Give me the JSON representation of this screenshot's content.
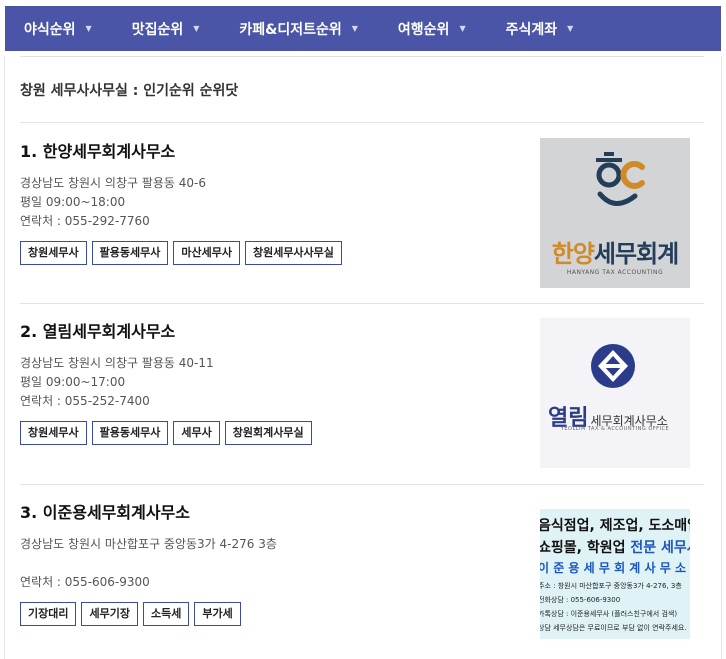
{
  "nav": {
    "items": [
      {
        "label": "야식순위"
      },
      {
        "label": "맛집순위"
      },
      {
        "label": "카페&디저트순위"
      },
      {
        "label": "여행순위"
      },
      {
        "label": "주식계좌"
      }
    ]
  },
  "page": {
    "title": "창원 세무사사무실 : 인기순위 순위닷"
  },
  "entries": [
    {
      "name": "1. 한양세무회계사무소",
      "address": "경상남도 창원시 의창구 팔용동 40-6",
      "hours": "평일 09:00~18:00",
      "phone": "연락처 : 055-292-7760",
      "tags": [
        "창원세무사",
        "팔용동세무사",
        "마산세무사",
        "창원세무사사무실"
      ],
      "thumb": {
        "brand": "한양세무회계",
        "brand_a": "한양",
        "brand_b": "세무회계",
        "eng": "HANYANG TAX ACCOUNTING"
      }
    },
    {
      "name": "2. 열림세무회계사무소",
      "address": "경상남도 창원시 의창구 팔용동 40-11",
      "hours": "평일 09:00~17:00",
      "phone": "연락처 : 055-252-7400",
      "tags": [
        "창원세무사",
        "팔용동세무사",
        "세무사",
        "창원회계사무실"
      ],
      "thumb": {
        "brand": "열림",
        "sub": "세무회계사무소",
        "eng": "YEOLLIM TAX & ACCOUNTING OFFICE"
      }
    },
    {
      "name": "3. 이준용세무회계사무소",
      "address": "경상남도 창원시 마산합포구 중앙동3가 4-276 3층",
      "hours": "",
      "phone": "연락처 : 055-606-9300",
      "tags": [
        "기장대리",
        "세무기장",
        "소득세",
        "부가세"
      ],
      "thumb": {
        "line1": "음식점업, 제조업, 도소매업",
        "line2_a": "쇼핑몰, 학원업 ",
        "line2_b": "전문 세무사",
        "line3": "이 준 용 세 무 회 계 사 무 소",
        "line4": "주소 : 창원시 마산합포구 중앙동3가 4-276, 3층",
        "line5": "전화상담 : 055-606-9300",
        "line6": "카톡상담 : 이준용세무사 (플러스친구에서 검색)",
        "line7": "상담 세무상담은 무료이므로 부담 없이 연락주세요."
      }
    }
  ],
  "colors": {
    "nav_bg": "#4a55a8",
    "tag_border": "#3b4aa5",
    "logo1_orange": "#d08a27",
    "logo1_navy": "#233d5a",
    "logo2_blue": "#2a3c8a",
    "ad_blue": "#1a55c0"
  },
  "icons": {
    "caret": "caret-down-icon",
    "logo1": "hanyang-logo-icon",
    "logo2": "yeollim-logo-icon"
  }
}
